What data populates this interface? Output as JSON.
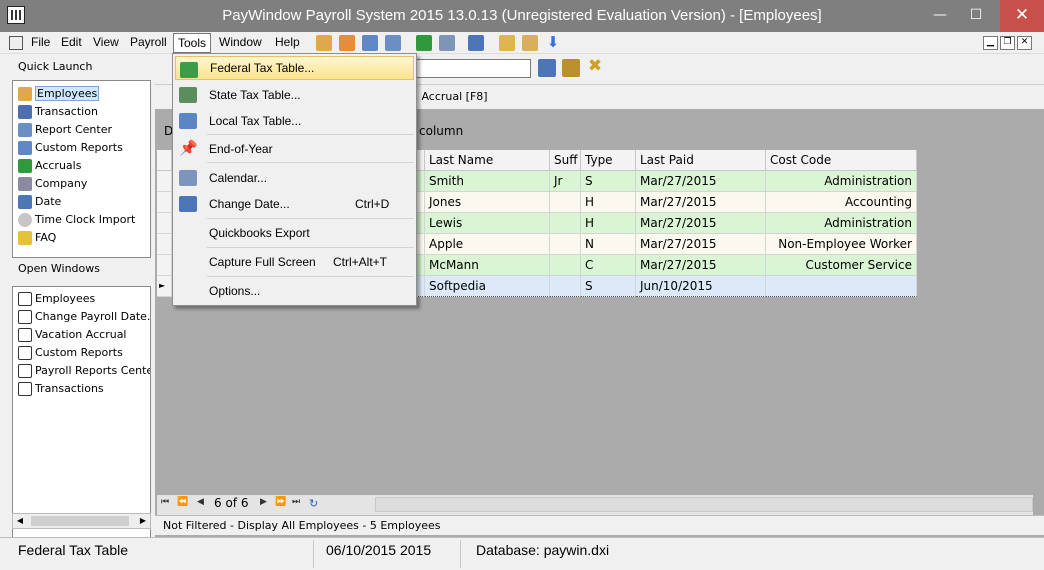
{
  "window": {
    "title": "PayWindow Payroll System 2015  13.0.13 (Unregistered Evaluation Version) - [Employees]",
    "minimize": "—",
    "maximize": "☐",
    "close": "✕"
  },
  "menubar": {
    "items": [
      "File",
      "Edit",
      "View",
      "Payroll",
      "Tools",
      "Window",
      "Help"
    ],
    "active": "Tools"
  },
  "mdi_controls": {
    "minimize": "▁",
    "restore": "❐",
    "close": "✕"
  },
  "quick_launch": {
    "title": "Quick Launch",
    "items": [
      "Employees",
      "Transaction",
      "Report Center",
      "Custom Reports",
      "Accruals",
      "Company",
      "Date",
      "Time Clock Import",
      "FAQ"
    ],
    "selected": "Employees"
  },
  "open_windows": {
    "title": "Open Windows",
    "items": [
      "Employees",
      "Change Payroll Date...",
      "Vacation Accrual",
      "Custom Reports",
      "Payroll Reports Center",
      "Transactions"
    ]
  },
  "employees_window": {
    "accrual_text": "n Accrual [F8]",
    "group_hint_left": "D",
    "group_hint_right": "column"
  },
  "grid": {
    "columns": [
      "Last Name",
      "Suff",
      "Type",
      "Last Paid",
      "Cost Code"
    ],
    "rows": [
      {
        "last_name": "Smith",
        "suff": "Jr",
        "type": "S",
        "last_paid": "Mar/27/2015",
        "cost_code": "Administration"
      },
      {
        "last_name": "Jones",
        "suff": "",
        "type": "H",
        "last_paid": "Mar/27/2015",
        "cost_code": "Accounting"
      },
      {
        "last_name": "Lewis",
        "suff": "",
        "type": "H",
        "last_paid": "Mar/27/2015",
        "cost_code": "Administration"
      },
      {
        "last_name": "Apple",
        "suff": "",
        "type": "N",
        "last_paid": "Mar/27/2015",
        "cost_code": "Non-Employee Worker"
      },
      {
        "last_name": "McMann",
        "suff": "",
        "type": "C",
        "last_paid": "Mar/27/2015",
        "cost_code": "Customer Service"
      },
      {
        "last_name": "Softpedia",
        "suff": "",
        "type": "S",
        "last_paid": "Jun/10/2015",
        "cost_code": ""
      }
    ],
    "current_row_marker": "►"
  },
  "navigator": {
    "page": "6 of 6"
  },
  "filter_status": "Not Filtered - Display All Employees - 5 Employees",
  "statusbar": {
    "hint": "Federal Tax Table",
    "date": "06/10/2015 2015",
    "database": "Database: paywin.dxi"
  },
  "tools_menu": {
    "items": [
      {
        "label": "Federal Tax Table...",
        "shortcut": ""
      },
      {
        "label": "State Tax Table...",
        "shortcut": ""
      },
      {
        "label": "Local Tax Table...",
        "shortcut": ""
      },
      {
        "label": "End-of-Year",
        "shortcut": ""
      },
      {
        "label": "Calendar...",
        "shortcut": ""
      },
      {
        "label": "Change Date...",
        "shortcut": "Ctrl+D"
      },
      {
        "label": "Quickbooks Export",
        "shortcut": ""
      },
      {
        "label": "Capture Full Screen",
        "shortcut": "Ctrl+Alt+T"
      },
      {
        "label": "Options...",
        "shortcut": ""
      }
    ],
    "highlighted": "Federal Tax Table..."
  },
  "colors": {
    "row_green": "#d9f5d3",
    "row_cream": "#fbf8ef",
    "row_selected": "#dbe9f8",
    "menu_highlight": "#fbe38e"
  }
}
